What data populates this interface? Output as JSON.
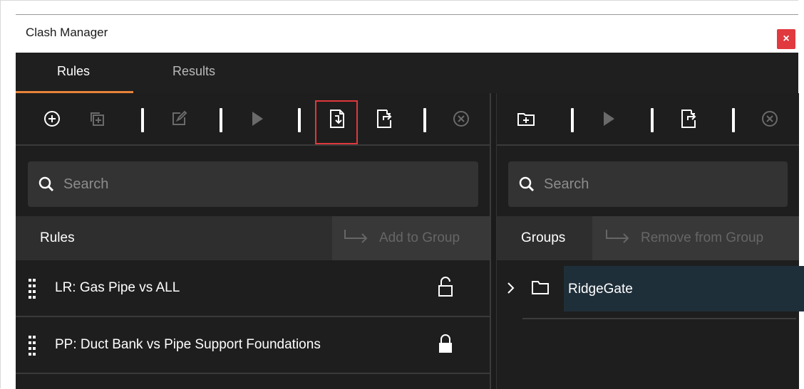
{
  "window": {
    "title": "Clash Manager",
    "close_label": "×"
  },
  "tabs": [
    {
      "label": "Rules",
      "active": true
    },
    {
      "label": "Results",
      "active": false
    }
  ],
  "left_pane": {
    "search": {
      "placeholder": "Search"
    },
    "header": {
      "label": "Rules",
      "action_label": "Add to Group"
    },
    "rules": [
      {
        "label": "LR: Gas Pipe vs ALL",
        "locked": false
      },
      {
        "label": "PP: Duct Bank vs Pipe Support Foundations",
        "locked": true
      }
    ]
  },
  "right_pane": {
    "search": {
      "placeholder": "Search"
    },
    "header": {
      "label": "Groups",
      "action_label": "Remove from Group"
    },
    "groups": [
      {
        "label": "RidgeGate",
        "expanded": false,
        "selected": true
      }
    ]
  },
  "colors": {
    "accent_tab": "#e7843a",
    "highlight_box": "#e0383c",
    "close_button": "#e0393e",
    "panel_bg": "#1e1e1e",
    "selection_bg": "#1f2f3a"
  },
  "icons": {
    "left_toolbar": [
      "add-circle-icon",
      "copy-icon",
      "edit-icon",
      "run-icon",
      "import-icon",
      "export-icon",
      "cancel-circle-icon"
    ],
    "right_toolbar": [
      "add-folder-icon",
      "run-icon",
      "export-icon",
      "cancel-circle-icon"
    ]
  }
}
